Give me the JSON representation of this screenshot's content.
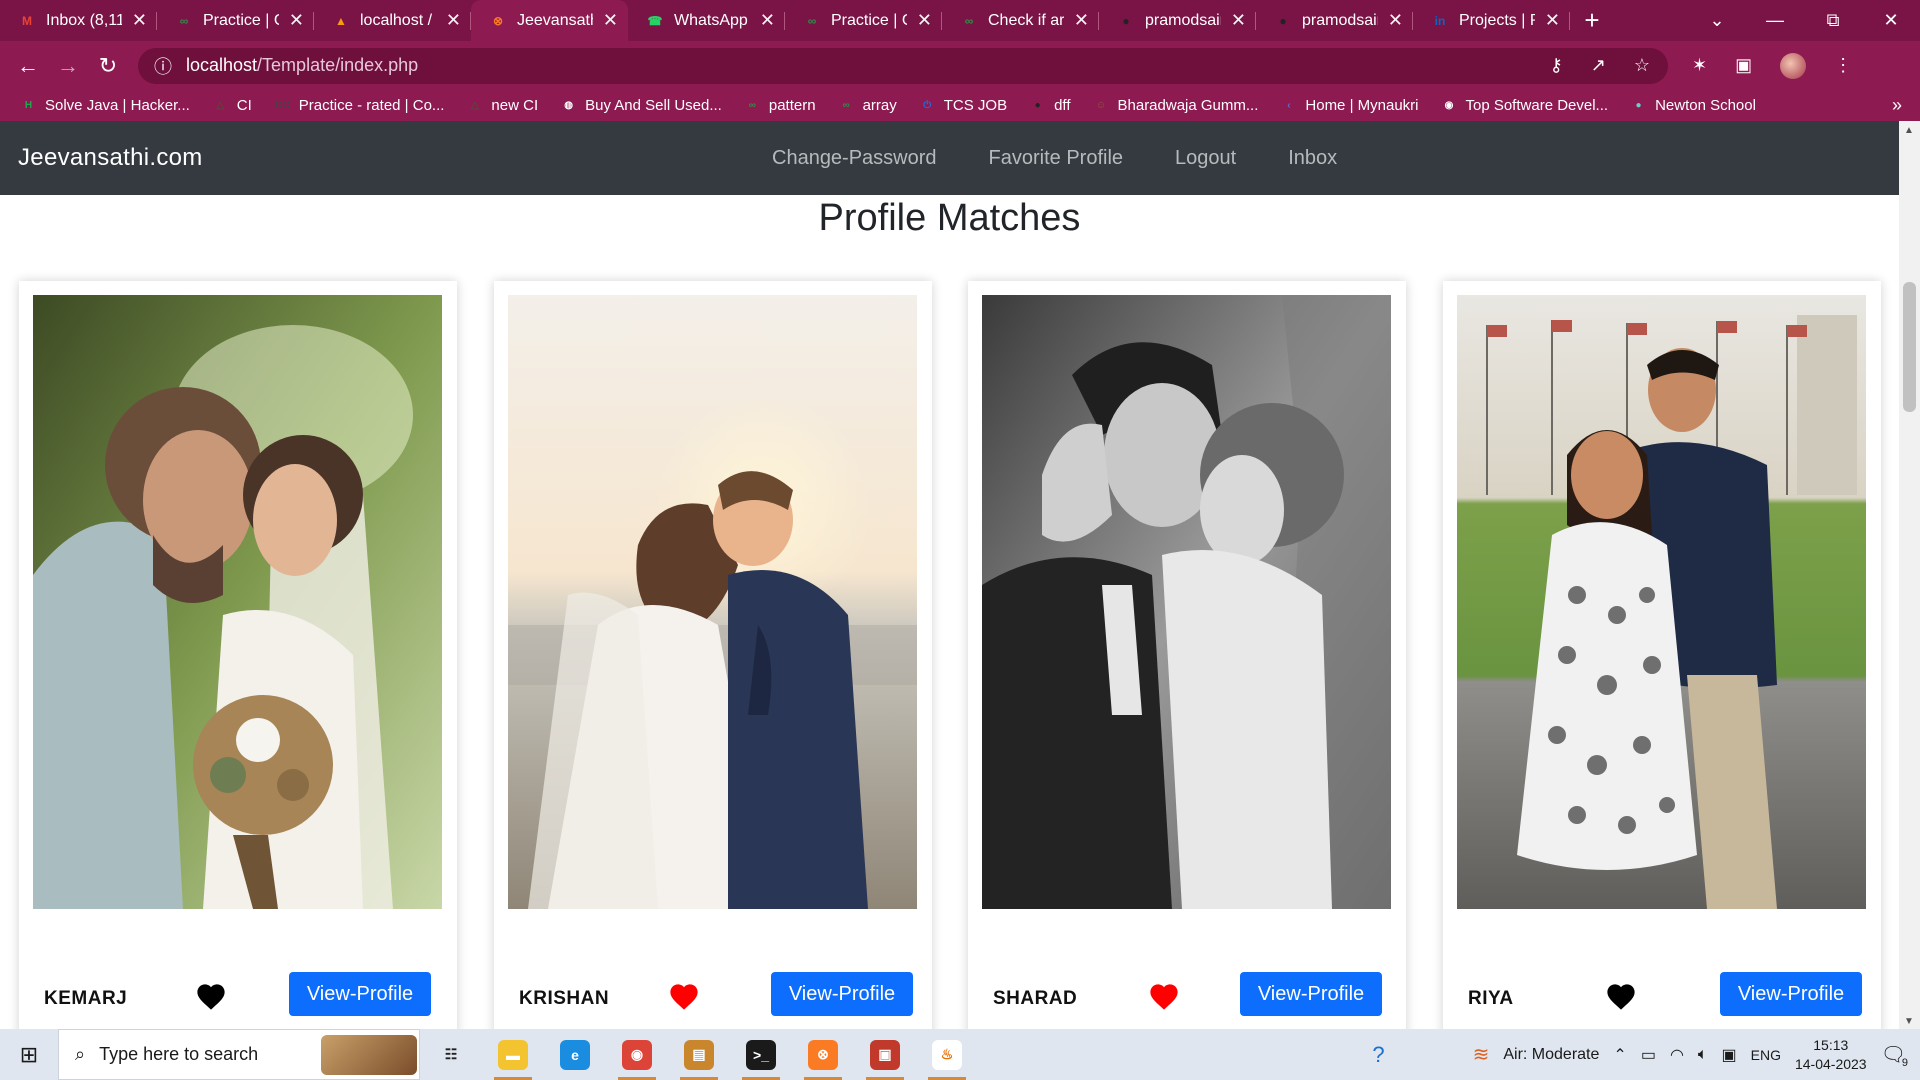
{
  "browser": {
    "tabs": [
      {
        "title": "Inbox (8,11",
        "favicon": "gmail-icon",
        "color": "#ea4335",
        "glyph": "M",
        "active": false
      },
      {
        "title": "Practice | Gr",
        "favicon": "gfg-icon",
        "color": "#2f8d46",
        "glyph": "∞",
        "active": false
      },
      {
        "title": "localhost /",
        "favicon": "phpmyadmin-icon",
        "color": "#f89c0e",
        "glyph": "▲",
        "active": false
      },
      {
        "title": "Jeevansathi",
        "favicon": "xampp-icon",
        "color": "#fb7a24",
        "glyph": "⊗",
        "active": true
      },
      {
        "title": "WhatsApp",
        "favicon": "whatsapp-icon",
        "color": "#25d366",
        "glyph": "☎",
        "active": false
      },
      {
        "title": "Practice | Gr",
        "favicon": "gfg-icon",
        "color": "#2f8d46",
        "glyph": "∞",
        "active": false
      },
      {
        "title": "Check if arr",
        "favicon": "gfg-icon",
        "color": "#2f8d46",
        "glyph": "∞",
        "active": false
      },
      {
        "title": "pramodsair",
        "favicon": "github-icon",
        "color": "#222222",
        "glyph": "●",
        "active": false
      },
      {
        "title": "pramodsair",
        "favicon": "github-icon",
        "color": "#222222",
        "glyph": "●",
        "active": false
      },
      {
        "title": "Projects | Pr",
        "favicon": "linkedin-icon",
        "color": "#0a66c2",
        "glyph": "in",
        "active": false
      }
    ],
    "new_tab": "+",
    "window_controls": {
      "dropdown": "⌄",
      "minimize": "—",
      "restore": "⧉",
      "close": "✕"
    },
    "address": {
      "host": "localhost",
      "path": "/Template/index.php"
    },
    "nav": {
      "back": "←",
      "forward": "→",
      "reload": "↻",
      "info": "ⓘ"
    },
    "omni_icons": {
      "key": "⚷",
      "share": "↗",
      "star": "☆"
    },
    "toolbar_icons": {
      "extensions": "✶",
      "sidepanel": "▣",
      "menu": "⋮"
    },
    "bookmarks": [
      {
        "label": "Solve Java | Hacker...",
        "icon": "hackerrank-icon",
        "color": "#1ba94c",
        "glyph": "H"
      },
      {
        "label": "CI",
        "icon": "codechef-icon",
        "color": "#5b4638",
        "glyph": "△"
      },
      {
        "label": "Practice - rated | Co...",
        "icon": "codechef-icon",
        "color": "#444444",
        "glyph": "CC"
      },
      {
        "label": "new CI",
        "icon": "codechef-icon",
        "color": "#5b4638",
        "glyph": "△"
      },
      {
        "label": "Buy And Sell Used...",
        "icon": "globe-icon",
        "color": "#ffffff",
        "glyph": "◍"
      },
      {
        "label": "pattern",
        "icon": "gfg-icon",
        "color": "#2f8d46",
        "glyph": "∞"
      },
      {
        "label": "array",
        "icon": "gfg-icon",
        "color": "#2f8d46",
        "glyph": "∞"
      },
      {
        "label": "TCS JOB",
        "icon": "power-icon",
        "color": "#1e6fd9",
        "glyph": "⏻"
      },
      {
        "label": "dff",
        "icon": "github-icon",
        "color": "#222222",
        "glyph": "●"
      },
      {
        "label": "Bharadwaja Gumm...",
        "icon": "profile-photo-icon",
        "color": "#8a5a3c",
        "glyph": "☺"
      },
      {
        "label": "Home | Mynaukri",
        "icon": "mynaukri-icon",
        "color": "#5a6dd8",
        "glyph": "‹"
      },
      {
        "label": "Top Software Devel...",
        "icon": "chrome-icon",
        "color": "#ffffff",
        "glyph": "◉"
      },
      {
        "label": "Newton School",
        "icon": "newton-icon",
        "color": "#5fd3c8",
        "glyph": "●"
      }
    ],
    "bookmarks_more": "»"
  },
  "site": {
    "brand": "Jeevansathi.com",
    "nav_links": [
      "Change-Password",
      "Favorite Profile",
      "Logout",
      "Inbox"
    ],
    "heading": "Profile Matches",
    "profiles": [
      {
        "name": "KEMARJ",
        "favorite": false,
        "heart_color": "#000000",
        "button": "View-Profile",
        "photo": "wedding-couple-bouquet"
      },
      {
        "name": "KRISHAN",
        "favorite": true,
        "heart_color": "#ff0000",
        "button": "View-Profile",
        "photo": "wedding-couple-sunset-beach"
      },
      {
        "name": "SHARAD",
        "favorite": true,
        "heart_color": "#ff0000",
        "button": "View-Profile",
        "photo": "wedding-couple-black-white"
      },
      {
        "name": "RIYA",
        "favorite": false,
        "heart_color": "#000000",
        "button": "View-Profile",
        "photo": "couple-park-flags"
      }
    ]
  },
  "taskbar": {
    "search_placeholder": "Type here to search",
    "apps": [
      {
        "name": "task-view-icon",
        "glyph": "☷",
        "color": "#dfe6ef",
        "fg": "#222222",
        "running": false
      },
      {
        "name": "file-explorer-icon",
        "glyph": "▬",
        "color": "#f4c430",
        "fg": "#ffffff",
        "running": true
      },
      {
        "name": "edge-icon",
        "glyph": "e",
        "color": "#1b8de0",
        "fg": "#ffffff",
        "running": false
      },
      {
        "name": "chrome-icon",
        "glyph": "◉",
        "color": "#db4437",
        "fg": "#ffffff",
        "running": true
      },
      {
        "name": "notepad-plus-icon",
        "glyph": "▤",
        "color": "#c9862c",
        "fg": "#ffffff",
        "running": true
      },
      {
        "name": "terminal-icon",
        "glyph": ">_",
        "color": "#1a1a1a",
        "fg": "#ffffff",
        "running": true
      },
      {
        "name": "xampp-icon",
        "glyph": "⊗",
        "color": "#fb7a24",
        "fg": "#ffffff",
        "running": true
      },
      {
        "name": "media-tool-icon",
        "glyph": "▣",
        "color": "#c0392b",
        "fg": "#ffffff",
        "running": true
      },
      {
        "name": "java-icon",
        "glyph": "♨",
        "color": "#ffffff",
        "fg": "#e76f00",
        "running": true
      }
    ],
    "air_quality": "Air: Moderate",
    "language": "ENG",
    "time": "15:13",
    "date": "14-04-2023",
    "notification_count": "9"
  }
}
